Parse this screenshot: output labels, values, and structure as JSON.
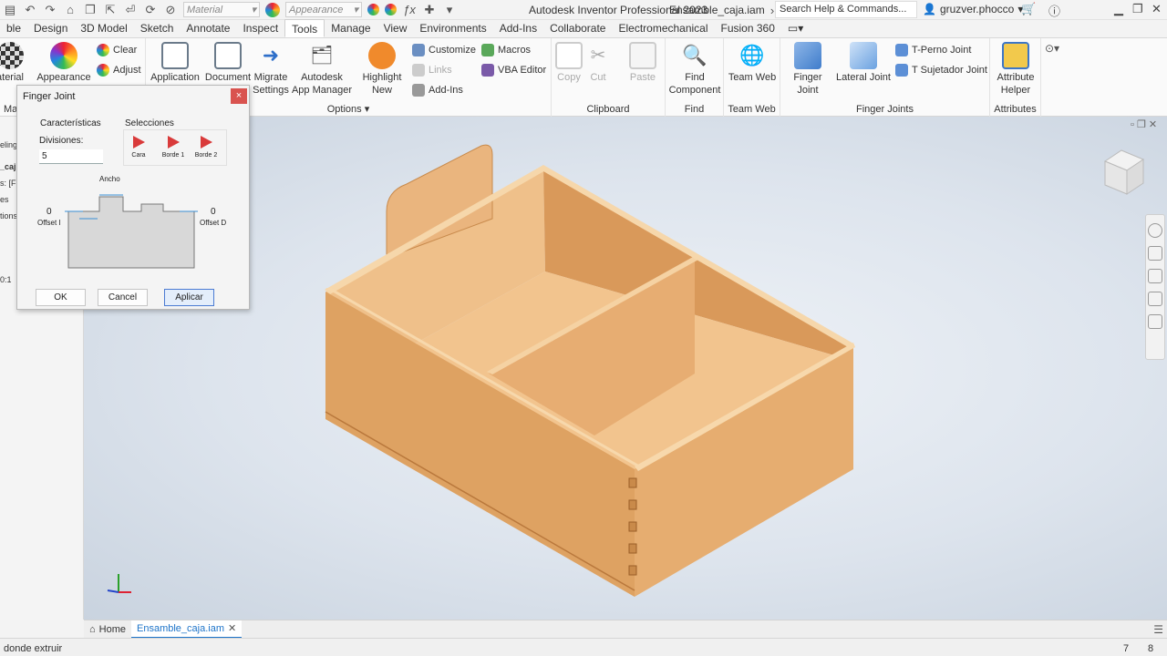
{
  "app": {
    "title": "Autodesk Inventor Professional 2023",
    "file": "Ensamble_caja.iam"
  },
  "quick_access": {
    "material_placeholder": "Material",
    "appearance_placeholder": "Appearance",
    "search_placeholder": "Search Help & Commands...",
    "user": "gruzver.phocco"
  },
  "tabs": [
    "ble",
    "Design",
    "3D Model",
    "Sketch",
    "Annotate",
    "Inspect",
    "Tools",
    "Manage",
    "View",
    "Environments",
    "Add-Ins",
    "Collaborate",
    "Electromechanical",
    "Fusion 360"
  ],
  "ribbon": {
    "material_label": "aterial",
    "appearance_label": "Appearance",
    "clear_label": "Clear",
    "adjust_label": "Adjust",
    "application_label": "Application",
    "document_label": "Document",
    "migrate_label_1": "Migrate",
    "migrate_label_2": "Settings",
    "autodesk_label_1": "Autodesk",
    "autodesk_label_2": "App Manager",
    "highlight_label_1": "Highlight",
    "highlight_label_2": "New",
    "customize_label": "Customize",
    "links_label": "Links",
    "addins_label": "Add-Ins",
    "macros_label": "Macros",
    "vba_label": "VBA Editor",
    "options_label": "Options",
    "copy_label": "Copy",
    "cut_label": "Cut",
    "paste_label": "Paste",
    "clipboard_label": "Clipboard",
    "find_label_1": "Find",
    "find_label_2": "Component",
    "find_panel": "Find",
    "teamweb_label": "Team Web",
    "teamweb_panel": "Team Web",
    "finger_joint_label": "Finger Joint",
    "lateral_joint_label": "Lateral Joint",
    "t_perno_label": "T-Perno Joint",
    "t_sujetador_label": "T Sujetador Joint",
    "finger_joints_panel": "Finger Joints",
    "attribute_label_1": "Attribute",
    "attribute_label_2": "Helper",
    "attributes_panel": "Attributes",
    "ma_label": "Ma"
  },
  "browser": {
    "items": [
      "eling",
      "_caj",
      "s: [F",
      "es",
      "tions",
      "0:1"
    ]
  },
  "dialog": {
    "title": "Finger Joint",
    "close": "×",
    "caracteristicas": "Características",
    "divisiones_label": "Divisiones:",
    "divisiones_value": "5",
    "selecciones": "Selecciones",
    "cara": "Cara",
    "borde1": "Borde 1",
    "borde2": "Borde 2",
    "ancho": "Ancho",
    "offset_i_value": "0",
    "offset_i_label": "Offset I",
    "offset_d_value": "0",
    "offset_d_label": "Offset D",
    "ok": "OK",
    "cancel": "Cancel",
    "apply": "Aplicar"
  },
  "doctabs": {
    "home": "Home",
    "active": "Ensamble_caja.iam"
  },
  "status": {
    "message": "donde extruir",
    "n1": "7",
    "n2": "8"
  },
  "colors": {
    "wood_top": "#e8b27a",
    "wood_side": "#dea060",
    "wood_dark": "#c98a4a",
    "accent": "#1e74c9"
  }
}
